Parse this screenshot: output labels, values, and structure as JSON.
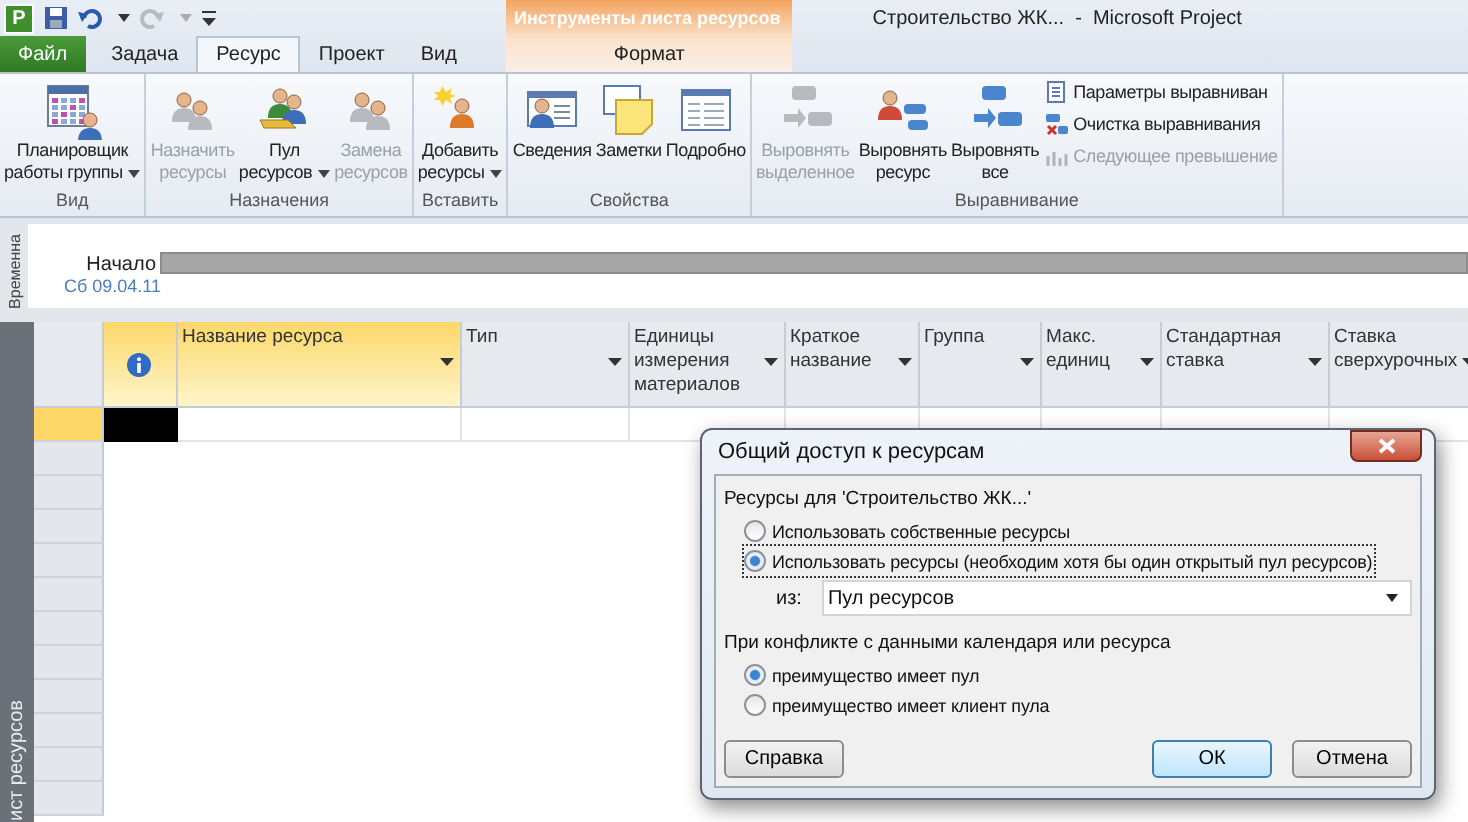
{
  "title_bar": {
    "app_badge": "P",
    "title": "Строительство ЖК...  -  Microsoft Project",
    "context_title": "Инструменты листа ресурсов"
  },
  "tabs": [
    {
      "label": "Файл",
      "kind": "file",
      "selected": false
    },
    {
      "label": "Задача",
      "kind": "normal",
      "selected": false
    },
    {
      "label": "Ресурс",
      "kind": "normal",
      "selected": true
    },
    {
      "label": "Проект",
      "kind": "normal",
      "selected": false
    },
    {
      "label": "Вид",
      "kind": "normal",
      "selected": false
    },
    {
      "label": "Формат",
      "kind": "context",
      "selected": false
    }
  ],
  "ribbon": {
    "groups": [
      {
        "label": "Вид",
        "items": [
          {
            "kind": "large",
            "label": "Планировщик\nработы группы",
            "dropdown": true,
            "disabled": false
          }
        ]
      },
      {
        "label": "Назначения",
        "items": [
          {
            "kind": "large",
            "label": "Назначить\nресурсы",
            "dropdown": false,
            "disabled": true
          },
          {
            "kind": "large",
            "label": "Пул\nресурсов",
            "dropdown": true,
            "disabled": false
          },
          {
            "kind": "large",
            "label": "Замена\nресурсов",
            "dropdown": false,
            "disabled": true
          }
        ]
      },
      {
        "label": "Вставить",
        "items": [
          {
            "kind": "large",
            "label": "Добавить\nресурсы",
            "dropdown": true,
            "disabled": false
          }
        ]
      },
      {
        "label": "Свойства",
        "items": [
          {
            "kind": "large",
            "label": "Сведения",
            "dropdown": false,
            "disabled": false
          },
          {
            "kind": "large",
            "label": "Заметки",
            "dropdown": false,
            "disabled": false
          },
          {
            "kind": "large",
            "label": "Подробно",
            "dropdown": false,
            "disabled": false
          }
        ]
      },
      {
        "label": "Выравнивание",
        "items": [
          {
            "kind": "large",
            "label": "Выровнять\nвыделенное",
            "dropdown": false,
            "disabled": true
          },
          {
            "kind": "large",
            "label": "Выровнять\nресурс",
            "dropdown": false,
            "disabled": false
          },
          {
            "kind": "large",
            "label": "Выровнять\nвсе",
            "dropdown": false,
            "disabled": false
          },
          {
            "kind": "small",
            "label": "Параметры выравниван",
            "dropdown": false,
            "disabled": false
          },
          {
            "kind": "small",
            "label": "Очистка выравнивания",
            "dropdown": false,
            "disabled": false
          },
          {
            "kind": "small",
            "label": "Следующее превышение",
            "dropdown": false,
            "disabled": true
          }
        ]
      }
    ]
  },
  "timeline": {
    "side_label": "Временна",
    "start_label": "Начало",
    "start_date": "Сб 09.04.11"
  },
  "sheet": {
    "side_label": "ист ресурсов",
    "columns": [
      {
        "kind": "info",
        "highlighted": true
      },
      {
        "kind": "text",
        "label": "Название ресурса",
        "highlighted": true
      },
      {
        "kind": "text",
        "label": "Тип",
        "highlighted": false
      },
      {
        "kind": "text",
        "label": "Единицы\nизмерения\nматериалов",
        "highlighted": false
      },
      {
        "kind": "text",
        "label": "Краткое\nназвание",
        "highlighted": false
      },
      {
        "kind": "text",
        "label": "Группа",
        "highlighted": false
      },
      {
        "kind": "text",
        "label": "Макс.\nединиц",
        "highlighted": false
      },
      {
        "kind": "text",
        "label": "Стандартная\nставка",
        "highlighted": false
      },
      {
        "kind": "text",
        "label": "Ставка\nсверхурочных",
        "highlighted": false
      }
    ],
    "rows": [
      {
        "selected": true
      },
      {
        "selected": false
      },
      {
        "selected": false
      },
      {
        "selected": false
      },
      {
        "selected": false
      },
      {
        "selected": false
      },
      {
        "selected": false
      },
      {
        "selected": false
      },
      {
        "selected": false
      },
      {
        "selected": false
      },
      {
        "selected": false
      },
      {
        "selected": false
      }
    ]
  },
  "dialog": {
    "title": "Общий доступ к ресурсам",
    "section_1": "Ресурсы для 'Строительство ЖК...'",
    "radios_1": [
      {
        "label": "Использовать собственные ресурсы",
        "selected": false,
        "focused": false
      },
      {
        "label": "Использовать ресурсы (необходим хотя бы один открытый пул ресурсов)",
        "selected": true,
        "focused": true
      }
    ],
    "from_label": "из:",
    "from_value": "Пул ресурсов",
    "section_2": "При конфликте с данными календаря или ресурса",
    "radios_2": [
      {
        "label": "преимущество имеет пул",
        "selected": true,
        "focused": false
      },
      {
        "label": "преимущество имеет клиент пула",
        "selected": false,
        "focused": false
      }
    ],
    "buttons": [
      {
        "label": "Справка",
        "default": false
      },
      {
        "label": "ОК",
        "default": true
      },
      {
        "label": "Отмена",
        "default": false
      }
    ]
  }
}
